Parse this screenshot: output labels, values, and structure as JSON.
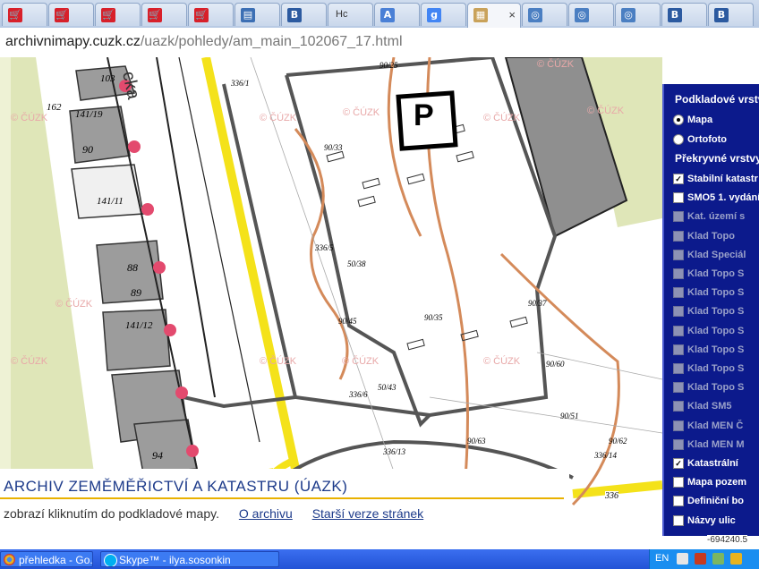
{
  "browser": {
    "tabs": [
      {
        "icon": "cart-icon",
        "label": ""
      },
      {
        "icon": "cart-icon",
        "label": ""
      },
      {
        "icon": "cart-icon",
        "label": ""
      },
      {
        "icon": "cart-icon",
        "label": ""
      },
      {
        "icon": "cart-icon",
        "label": ""
      },
      {
        "icon": "document-icon",
        "label": ""
      },
      {
        "icon": "b-icon",
        "label": ""
      },
      {
        "icon": "text-icon",
        "label": "Hc"
      },
      {
        "icon": "translate-icon",
        "label": ""
      },
      {
        "icon": "google-icon",
        "label": ""
      },
      {
        "icon": "map-icon",
        "label": "",
        "active": true
      },
      {
        "icon": "globe-icon",
        "label": ""
      },
      {
        "icon": "globe-icon",
        "label": ""
      },
      {
        "icon": "globe-icon",
        "label": ""
      },
      {
        "icon": "b-icon",
        "label": ""
      },
      {
        "icon": "b-icon",
        "label": ""
      }
    ],
    "close_glyph": "×",
    "url_host": "archivnimapy.cuzk.cz",
    "url_path": "/uazk/pohledy/am_main_102067_17.html"
  },
  "map": {
    "watermark": "© ČÚZK",
    "parking_label": "P",
    "street_label": "cka",
    "parcel_labels": [
      "103",
      "162",
      "141/19",
      "90",
      "141/11",
      "88",
      "89",
      "141/12",
      "94",
      "336/1",
      "90/25",
      "90/33",
      "50/38",
      "90/45",
      "90/35",
      "90/37",
      "90/60",
      "90/51",
      "90/63",
      "90/62",
      "336/6",
      "336/5",
      "336/13",
      "50/43",
      "336/14"
    ],
    "scale_text": "336",
    "coord_readout": "-694240.5"
  },
  "layers_panel": {
    "base_title": "Podkladové vrstvy",
    "base_options": [
      {
        "label": "Mapa",
        "selected": true
      },
      {
        "label": "Ortofoto",
        "selected": false
      }
    ],
    "overlay_title": "Překryvné vrstvy",
    "overlays": [
      {
        "label": "Stabilní katastr",
        "checked": true,
        "enabled": true
      },
      {
        "label": "SMO5 1. vydání",
        "checked": false,
        "enabled": true
      },
      {
        "label": "Kat. území s",
        "checked": false,
        "enabled": false
      },
      {
        "label": "Klad Topo",
        "checked": false,
        "enabled": false
      },
      {
        "label": "Klad Speciál",
        "checked": false,
        "enabled": false
      },
      {
        "label": "Klad Topo S",
        "checked": false,
        "enabled": false
      },
      {
        "label": "Klad Topo S",
        "checked": false,
        "enabled": false
      },
      {
        "label": "Klad Topo S",
        "checked": false,
        "enabled": false
      },
      {
        "label": "Klad Topo S",
        "checked": false,
        "enabled": false
      },
      {
        "label": "Klad Topo S",
        "checked": false,
        "enabled": false
      },
      {
        "label": "Klad Topo S",
        "checked": false,
        "enabled": false
      },
      {
        "label": "Klad Topo S",
        "checked": false,
        "enabled": false
      },
      {
        "label": "Klad SM5",
        "checked": false,
        "enabled": false
      },
      {
        "label": "Klad MEN Č",
        "checked": false,
        "enabled": false
      },
      {
        "label": "Klad MEN M",
        "checked": false,
        "enabled": false
      },
      {
        "label": "Katastrální",
        "checked": true,
        "enabled": true
      },
      {
        "label": "Mapa pozem",
        "checked": false,
        "enabled": true
      },
      {
        "label": "Definiční bo",
        "checked": false,
        "enabled": true
      },
      {
        "label": "Názvy ulic",
        "checked": false,
        "enabled": true
      }
    ]
  },
  "archive": {
    "title": "ARCHIV ZEMĚMĚŘICTVÍ A KATASTRU (ÚAZK)",
    "text": "zobrazí kliknutím do podkladové mapy.",
    "link_archive": "O archivu",
    "link_old": "Starší verze stránek"
  },
  "taskbar": {
    "items": [
      {
        "label": "přehledka - Go...",
        "icon": "chrome-icon"
      },
      {
        "label": "Skype™ - ilya.sosonkin",
        "icon": "skype-icon"
      }
    ],
    "language": "EN"
  },
  "colors": {
    "tab_bar": "#c9d7eb",
    "panel_bg": "#0c1a8c",
    "archive_title": "#1c3a8a",
    "rule": "#e9b100",
    "road_yellow": "#f4e21a",
    "contour": "#d48a5a",
    "taskbar": "#2253d6"
  }
}
